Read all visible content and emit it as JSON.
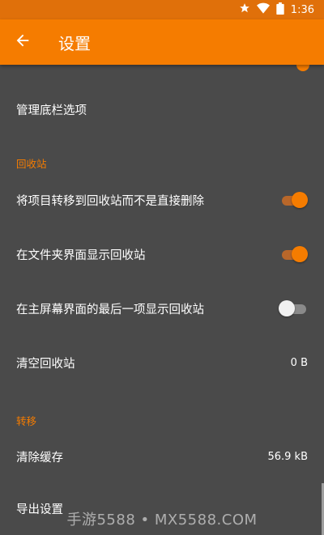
{
  "status_bar": {
    "time": "1:36",
    "icons": [
      "star-icon",
      "wifi-icon",
      "battery-icon"
    ]
  },
  "app_bar": {
    "title": "设置",
    "back_icon": "arrow-back-icon"
  },
  "colors": {
    "accent": "#f57c00",
    "background": "#4a4a4a",
    "statusbar": "#e0700a"
  },
  "rows": {
    "manage_bottom_tabs": "管理底栏选项",
    "recycle_header": "回收站",
    "move_to_recycle": {
      "label": "将项目转移到回收站而不是直接删除",
      "enabled": true
    },
    "show_recycle_in_folders": {
      "label": "在文件夹界面显示回收站",
      "enabled": true
    },
    "show_recycle_last_on_main": {
      "label": "在主屏幕界面的最后一项显示回收站",
      "enabled": false
    },
    "empty_recycle": {
      "label": "清空回收站",
      "value": "0 B"
    },
    "migrate_header": "转移",
    "clear_cache": {
      "label": "清除缓存",
      "value": "56.9 kB"
    },
    "export_settings": "导出设置"
  },
  "watermark": "手游5588 • MX5588.COM"
}
